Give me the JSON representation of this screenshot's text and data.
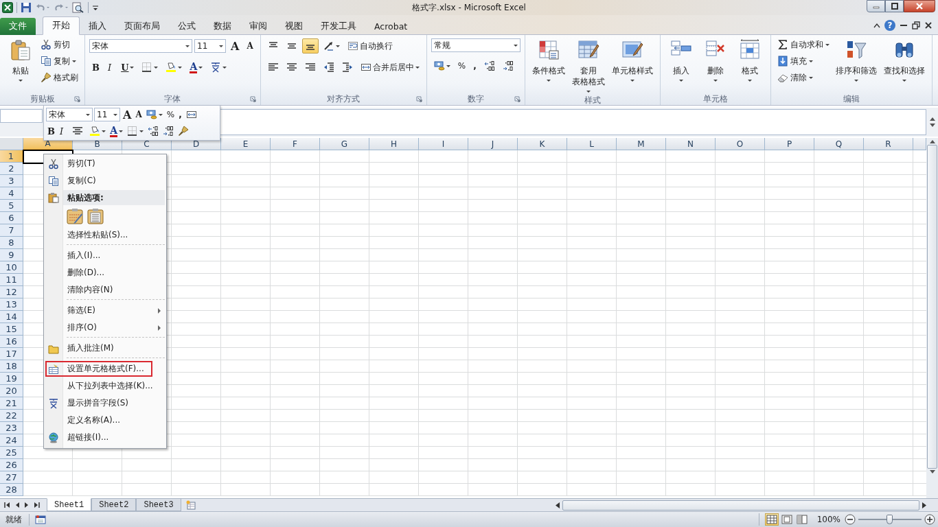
{
  "window": {
    "title": "格式字.xlsx - Microsoft Excel"
  },
  "ribbon": {
    "tabs": [
      {
        "label": "文件",
        "kind": "file",
        "selected": false
      },
      {
        "label": "开始",
        "kind": "tab",
        "selected": true
      },
      {
        "label": "插入",
        "kind": "tab",
        "selected": false
      },
      {
        "label": "页面布局",
        "kind": "tab",
        "selected": false
      },
      {
        "label": "公式",
        "kind": "tab",
        "selected": false
      },
      {
        "label": "数据",
        "kind": "tab",
        "selected": false
      },
      {
        "label": "审阅",
        "kind": "tab",
        "selected": false
      },
      {
        "label": "视图",
        "kind": "tab",
        "selected": false
      },
      {
        "label": "开发工具",
        "kind": "tab",
        "selected": false
      },
      {
        "label": "Acrobat",
        "kind": "tab",
        "selected": false
      }
    ],
    "help": "?",
    "groups": [
      {
        "label": "剪贴板",
        "launcher": true,
        "blocks": [
          {
            "kind": "large",
            "items": [
              {
                "kind": "paste",
                "label": "粘贴",
                "menu": true
              }
            ]
          },
          {
            "kind": "stack",
            "items": [
              {
                "kind": "cut",
                "label": "剪切"
              },
              {
                "kind": "copy",
                "label": "复制",
                "menu": true
              },
              {
                "kind": "painter",
                "label": "格式刷"
              }
            ]
          }
        ]
      },
      {
        "label": "字体",
        "launcher": true,
        "blocks": [
          {
            "kind": "rows",
            "rows": [
              {
                "items": [
                  {
                    "kind": "font",
                    "value": "宋体"
                  },
                  {
                    "kind": "size",
                    "value": "11"
                  },
                  {
                    "kind": "grow",
                    "label": "A"
                  },
                  {
                    "kind": "shrink",
                    "label": "A"
                  }
                ]
              },
              {
                "items": [
                  {
                    "kind": "bold",
                    "label": "B"
                  },
                  {
                    "kind": "italic",
                    "label": "I"
                  },
                  {
                    "kind": "underline",
                    "label": "U",
                    "menu": true
                  },
                  {
                    "kind": "borders",
                    "menu": true
                  },
                  {
                    "kind": "fill",
                    "menu": true
                  },
                  {
                    "kind": "fontcolor",
                    "label": "A",
                    "menu": true
                  },
                  {
                    "kind": "phonetic",
                    "menu": true
                  }
                ]
              }
            ]
          }
        ]
      },
      {
        "label": "对齐方式",
        "launcher": true,
        "blocks": [
          {
            "kind": "rows",
            "rows": [
              {
                "items": [
                  {
                    "kind": "top",
                    "selected": false
                  },
                  {
                    "kind": "middle",
                    "selected": false
                  },
                  {
                    "kind": "bottom",
                    "selected": true
                  },
                  {
                    "kind": "orient",
                    "menu": true
                  },
                  {
                    "kind": "wrap",
                    "label": "自动换行",
                    "selected": false
                  }
                ]
              },
              {
                "items": [
                  {
                    "kind": "left",
                    "selected": false
                  },
                  {
                    "kind": "center",
                    "selected": false
                  },
                  {
                    "kind": "right",
                    "selected": false
                  },
                  {
                    "kind": "outdent"
                  },
                  {
                    "kind": "indent"
                  },
                  {
                    "kind": "merge",
                    "label": "合并后居中",
                    "menu": true,
                    "selected": false
                  }
                ]
              }
            ]
          }
        ]
      },
      {
        "label": "数字",
        "launcher": true,
        "blocks": [
          {
            "kind": "rows",
            "rows": [
              {
                "items": [
                  {
                    "kind": "format",
                    "value": "常规"
                  }
                ]
              },
              {
                "items": [
                  {
                    "kind": "currency",
                    "menu": true
                  },
                  {
                    "kind": "percent",
                    "label": "%"
                  },
                  {
                    "kind": "comma",
                    "label": ","
                  },
                  {
                    "kind": "incdec"
                  },
                  {
                    "kind": "decdec"
                  }
                ]
              }
            ]
          }
        ]
      },
      {
        "label": "样式",
        "blocks": [
          {
            "kind": "large",
            "items": [
              {
                "kind": "conditional",
                "label": "条件格式",
                "menu": true
              },
              {
                "kind": "table",
                "lines": [
                  "套用",
                  "表格格式"
                ],
                "menu": true
              },
              {
                "kind": "cellstyle",
                "label": "单元格样式",
                "menu": true
              }
            ]
          }
        ]
      },
      {
        "label": "单元格",
        "blocks": [
          {
            "kind": "large",
            "items": [
              {
                "kind": "insert",
                "label": "插入",
                "menu": true
              },
              {
                "kind": "delete",
                "label": "删除",
                "menu": true
              },
              {
                "kind": "cellformat",
                "label": "格式",
                "menu": true
              }
            ]
          }
        ]
      },
      {
        "label": "编辑",
        "blocks": [
          {
            "kind": "stack",
            "items": [
              {
                "kind": "autosum",
                "label": "自动求和",
                "menu": true
              },
              {
                "kind": "filldown",
                "label": "填充",
                "menu": true
              },
              {
                "kind": "clear",
                "label": "清除",
                "menu": true
              }
            ]
          },
          {
            "kind": "large",
            "items": [
              {
                "kind": "sort",
                "label": "排序和筛选",
                "menu": true
              },
              {
                "kind": "find",
                "label": "查找和选择",
                "menu": true
              }
            ]
          }
        ]
      }
    ]
  },
  "mini_toolbar": {
    "rows": [
      {
        "items": [
          {
            "kind": "font",
            "value": "宋体"
          },
          {
            "kind": "size",
            "value": "11"
          },
          {
            "kind": "grow",
            "label": "A"
          },
          {
            "kind": "shrink",
            "label": "A"
          },
          {
            "kind": "currency",
            "menu": true
          },
          {
            "kind": "percent",
            "label": "%"
          },
          {
            "kind": "comma",
            "label": ","
          },
          {
            "kind": "merge"
          }
        ]
      },
      {
        "items": [
          {
            "kind": "bold",
            "label": "B"
          },
          {
            "kind": "italic",
            "label": "I"
          },
          {
            "kind": "center"
          },
          {
            "kind": "fill",
            "menu": true
          },
          {
            "kind": "fontcolor",
            "label": "A",
            "menu": true
          },
          {
            "kind": "borders",
            "menu": true
          },
          {
            "kind": "incdec"
          },
          {
            "kind": "decdec"
          },
          {
            "kind": "painter"
          }
        ]
      }
    ]
  },
  "sheet": {
    "columns": [
      {
        "label": "A",
        "selected": true
      },
      {
        "label": "B",
        "selected": false
      },
      {
        "label": "C",
        "selected": false
      },
      {
        "label": "D",
        "selected": false
      },
      {
        "label": "E",
        "selected": false
      },
      {
        "label": "F",
        "selected": false
      },
      {
        "label": "G",
        "selected": false
      },
      {
        "label": "H",
        "selected": false
      },
      {
        "label": "I",
        "selected": false
      },
      {
        "label": "J",
        "selected": false
      },
      {
        "label": "K",
        "selected": false
      },
      {
        "label": "L",
        "selected": false
      },
      {
        "label": "M",
        "selected": false
      },
      {
        "label": "N",
        "selected": false
      },
      {
        "label": "O",
        "selected": false
      },
      {
        "label": "P",
        "selected": false
      },
      {
        "label": "Q",
        "selected": false
      },
      {
        "label": "R",
        "selected": false
      }
    ],
    "rows": [
      {
        "label": "1",
        "selected": true
      },
      {
        "label": "2",
        "selected": false
      },
      {
        "label": "3",
        "selected": false
      },
      {
        "label": "4",
        "selected": false
      },
      {
        "label": "5",
        "selected": false
      },
      {
        "label": "6",
        "selected": false
      },
      {
        "label": "7",
        "selected": false
      },
      {
        "label": "8",
        "selected": false
      },
      {
        "label": "9",
        "selected": false
      },
      {
        "label": "10",
        "selected": false
      },
      {
        "label": "11",
        "selected": false
      },
      {
        "label": "12",
        "selected": false
      },
      {
        "label": "13",
        "selected": false
      },
      {
        "label": "14",
        "selected": false
      },
      {
        "label": "15",
        "selected": false
      },
      {
        "label": "16",
        "selected": false
      },
      {
        "label": "17",
        "selected": false
      },
      {
        "label": "18",
        "selected": false
      },
      {
        "label": "19",
        "selected": false
      },
      {
        "label": "20",
        "selected": false
      },
      {
        "label": "21",
        "selected": false
      },
      {
        "label": "22",
        "selected": false
      },
      {
        "label": "23",
        "selected": false
      },
      {
        "label": "24",
        "selected": false
      },
      {
        "label": "25",
        "selected": false
      },
      {
        "label": "26",
        "selected": false
      },
      {
        "label": "27",
        "selected": false
      },
      {
        "label": "28",
        "selected": false
      }
    ]
  },
  "context_menu": [
    {
      "kind": "cut",
      "label": "剪切(T)"
    },
    {
      "kind": "copy",
      "label": "复制(C)"
    },
    {
      "kind": "paste-header",
      "label": "粘贴选项:"
    },
    {
      "kind": "paste-options"
    },
    {
      "kind": "command",
      "label": "选择性粘贴(S)..."
    },
    {
      "kind": "command",
      "label": "插入(I)...",
      "separator_above": true
    },
    {
      "kind": "command",
      "label": "删除(D)..."
    },
    {
      "kind": "command",
      "label": "清除内容(N)"
    },
    {
      "kind": "command",
      "label": "筛选(E)",
      "separator_above": true,
      "submenu": true
    },
    {
      "kind": "command",
      "label": "排序(O)",
      "submenu": true
    },
    {
      "kind": "comment",
      "label": "插入批注(M)",
      "separator_above": true
    },
    {
      "kind": "format-cells",
      "label": "设置单元格格式(F)...",
      "separator_above": true,
      "marked": true
    },
    {
      "kind": "command",
      "label": "从下拉列表中选择(K)..."
    },
    {
      "kind": "phonetic",
      "label": "显示拼音字段(S)"
    },
    {
      "kind": "command",
      "label": "定义名称(A)..."
    },
    {
      "kind": "hyperlink",
      "label": "超链接(I)..."
    }
  ],
  "sheet_tabs": [
    {
      "label": "Sheet1",
      "selected": true
    },
    {
      "label": "Sheet2",
      "selected": false
    },
    {
      "label": "Sheet3",
      "selected": false
    }
  ],
  "status_bar": {
    "text": "就绪",
    "views": [
      {
        "kind": "normal",
        "selected": true
      },
      {
        "kind": "layout",
        "selected": false
      },
      {
        "kind": "pagebreak",
        "selected": false
      }
    ],
    "zoom": "100%",
    "zoom_slider": {
      "level": 0.5
    }
  }
}
